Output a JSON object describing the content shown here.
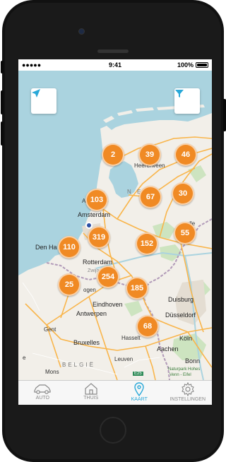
{
  "statusbar": {
    "signal": "●●●●● ",
    "time": "9:41",
    "battery": "100%"
  },
  "map": {
    "labels": {
      "heerenveen": "Heerenveen",
      "ned": "N E D",
      "alkmaar": "Alkma",
      "amsterdam": "Amsterdam",
      "zwolle": "wolle",
      "den_haag": "Den Ha",
      "rotterdam": "Rotterdam",
      "zwijndrecht": "Zwijndrecht",
      "roosendaal": "ogen",
      "eindhoven": "Eindhoven",
      "antwerpen": "Antwerpen",
      "duisburg": "Duisburg",
      "dusseldorf": "Düsseldorf",
      "gent": "Gent",
      "bruxelles": "Bruxelles",
      "hasselt": "Hasselt",
      "koln": "Köln",
      "aachen": "Aachen",
      "bonn": "Bonn",
      "belgie": "BELGIË",
      "naturpark": "Naturpark Hohes",
      "venn": "Venn - Eifel",
      "lille": "e",
      "leuven": "Leuven",
      "mons": "Mons",
      "e_numbers": [
        "E25"
      ]
    },
    "clusters": [
      {
        "id": "c2",
        "count": "2"
      },
      {
        "id": "c39",
        "count": "39"
      },
      {
        "id": "c46",
        "count": "46"
      },
      {
        "id": "c103",
        "count": "103"
      },
      {
        "id": "c67",
        "count": "67"
      },
      {
        "id": "c30",
        "count": "30"
      },
      {
        "id": "c319",
        "count": "319"
      },
      {
        "id": "c55",
        "count": "55"
      },
      {
        "id": "c110",
        "count": "110"
      },
      {
        "id": "c152",
        "count": "152"
      },
      {
        "id": "c254",
        "count": "254"
      },
      {
        "id": "c25",
        "count": "25"
      },
      {
        "id": "c185",
        "count": "185"
      },
      {
        "id": "c68",
        "count": "68"
      }
    ],
    "buttons": {
      "locate": "location-arrow-icon",
      "filter": "funnel-filter-icon"
    },
    "colors": {
      "cluster": "#f08a24",
      "sea": "#aad3df",
      "land": "#f2efe9",
      "accent": "#29a8d8"
    }
  },
  "tabs": [
    {
      "label": "AUTO",
      "icon": "car-icon"
    },
    {
      "label": "THUIS",
      "icon": "house-icon"
    },
    {
      "label": "KAART",
      "icon": "map-pin-icon",
      "active": true
    },
    {
      "label": "INSTELLINGEN",
      "icon": "gear-icon"
    }
  ]
}
